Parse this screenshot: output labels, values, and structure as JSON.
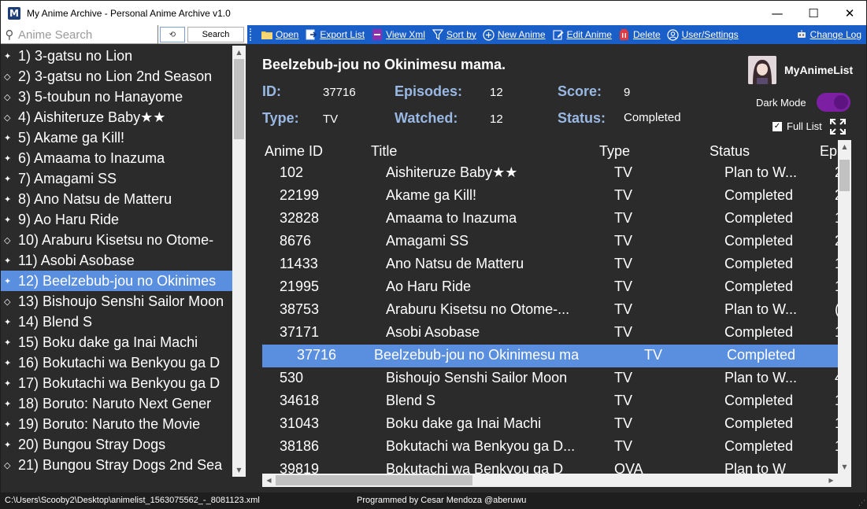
{
  "window": {
    "title": "My Anime Archive - Personal Anime Archive v1.0",
    "app_icon": "M",
    "minimize": "—",
    "maximize": "☐",
    "close": "✕"
  },
  "search": {
    "placeholder": "Anime Search",
    "value": "",
    "reset_icon": "⟲",
    "button_label": "Search"
  },
  "toolbar": {
    "items": [
      {
        "label": "Open",
        "icon": "folder-icon"
      },
      {
        "label": "Export List",
        "icon": "export-icon"
      },
      {
        "label": "View Xml",
        "icon": "xml-icon"
      },
      {
        "label": "Sort by",
        "icon": "filter-icon"
      },
      {
        "label": "New Anime",
        "icon": "plus-icon"
      },
      {
        "label": "Edit Anime",
        "icon": "edit-icon"
      },
      {
        "label": "Delete",
        "icon": "trash-icon"
      },
      {
        "label": "User/Settings",
        "icon": "user-icon"
      }
    ],
    "change_log": "Change Log"
  },
  "anime_list": [
    {
      "text": "1) 3-gatsu no Lion",
      "bullet": "✦"
    },
    {
      "text": "2) 3-gatsu no Lion 2nd Season",
      "bullet": "◇"
    },
    {
      "text": "3) 5-toubun no Hanayome",
      "bullet": "◇"
    },
    {
      "text": "4)  Aishiteruze Baby★★",
      "bullet": "◇"
    },
    {
      "text": "5) Akame ga Kill!",
      "bullet": "✦"
    },
    {
      "text": "6) Amaama to Inazuma",
      "bullet": "✦"
    },
    {
      "text": "7) Amagami SS",
      "bullet": "✦"
    },
    {
      "text": "8) Ano Natsu de Matteru",
      "bullet": "✦"
    },
    {
      "text": "9) Ao Haru Ride",
      "bullet": "✦"
    },
    {
      "text": "10) Araburu Kisetsu no Otome-",
      "bullet": "◇"
    },
    {
      "text": "11) Asobi Asobase",
      "bullet": "✦"
    },
    {
      "text": "12) Beelzebub-jou no Okinimes",
      "bullet": "✦"
    },
    {
      "text": "13) Bishoujo Senshi Sailor Moon",
      "bullet": "◇"
    },
    {
      "text": "14) Blend S",
      "bullet": "✦"
    },
    {
      "text": "15) Boku dake ga Inai Machi",
      "bullet": "✦"
    },
    {
      "text": "16) Bokutachi wa Benkyou ga D",
      "bullet": "✦"
    },
    {
      "text": "17) Bokutachi wa Benkyou ga D",
      "bullet": "✦"
    },
    {
      "text": "18) Boruto: Naruto Next Gener",
      "bullet": "✦"
    },
    {
      "text": "19) Boruto: Naruto the Movie",
      "bullet": "✦"
    },
    {
      "text": "20) Bungou Stray Dogs",
      "bullet": "✦"
    },
    {
      "text": "21) Bungou Stray Dogs 2nd Sea",
      "bullet": "◇"
    }
  ],
  "selected_index": 11,
  "details": {
    "title": "Beelzebub-jou no Okinimesu mama.",
    "id_label": "ID:",
    "id_value": "37716",
    "episodes_label": "Episodes:",
    "episodes_value": "12",
    "score_label": "Score:",
    "score_value": "9",
    "type_label": "Type:",
    "type_value": "TV",
    "watched_label": "Watched:",
    "watched_value": "12",
    "status_label": "Status:",
    "status_value": "Completed"
  },
  "mal_label": "MyAnimeList",
  "dark_mode": {
    "label": "Dark Mode",
    "on": true
  },
  "full_list": {
    "label": "Full List",
    "checked": true
  },
  "grid": {
    "columns": [
      "Anime ID",
      "Title",
      "Type",
      "Status",
      "Epi"
    ],
    "rows": [
      {
        "id": "102",
        "title": "Aishiteruze Baby★★",
        "type": "TV",
        "status": "Plan to W...",
        "ep": "2"
      },
      {
        "id": "22199",
        "title": "Akame ga Kill!",
        "type": "TV",
        "status": "Completed",
        "ep": "2"
      },
      {
        "id": "32828",
        "title": "Amaama to Inazuma",
        "type": "TV",
        "status": "Completed",
        "ep": "1"
      },
      {
        "id": "8676",
        "title": "Amagami SS",
        "type": "TV",
        "status": "Completed",
        "ep": "2"
      },
      {
        "id": "11433",
        "title": "Ano Natsu de Matteru",
        "type": "TV",
        "status": "Completed",
        "ep": "1"
      },
      {
        "id": "21995",
        "title": "Ao Haru Ride",
        "type": "TV",
        "status": "Completed",
        "ep": "1"
      },
      {
        "id": "38753",
        "title": "Araburu Kisetsu no Otome-...",
        "type": "TV",
        "status": "Plan to W...",
        "ep": "("
      },
      {
        "id": "37171",
        "title": "Asobi Asobase",
        "type": "TV",
        "status": "Completed",
        "ep": "1"
      },
      {
        "id": "37716",
        "title": "Beelzebub-jou no Okinimesu ma",
        "type": "TV",
        "status": "Completed",
        "ep": ""
      },
      {
        "id": "530",
        "title": "Bishoujo Senshi Sailor Moon",
        "type": "TV",
        "status": "Plan to W...",
        "ep": "4"
      },
      {
        "id": "34618",
        "title": "Blend S",
        "type": "TV",
        "status": "Completed",
        "ep": "1"
      },
      {
        "id": "31043",
        "title": "Boku dake ga Inai Machi",
        "type": "TV",
        "status": "Completed",
        "ep": "1"
      },
      {
        "id": "38186",
        "title": "Bokutachi wa Benkyou ga D...",
        "type": "TV",
        "status": "Completed",
        "ep": "1"
      },
      {
        "id": "39819",
        "title": "Bokutachi wa Benkyou ga D",
        "type": "OVA",
        "status": "Plan to W",
        "ep": ""
      }
    ],
    "selected_row": 8
  },
  "statusbar": {
    "path": "C:\\Users\\Scooby2\\Desktop\\animelist_1563075562_-_8081123.xml",
    "credit": "Programmed by Cesar Mendoza @aberuwu"
  }
}
